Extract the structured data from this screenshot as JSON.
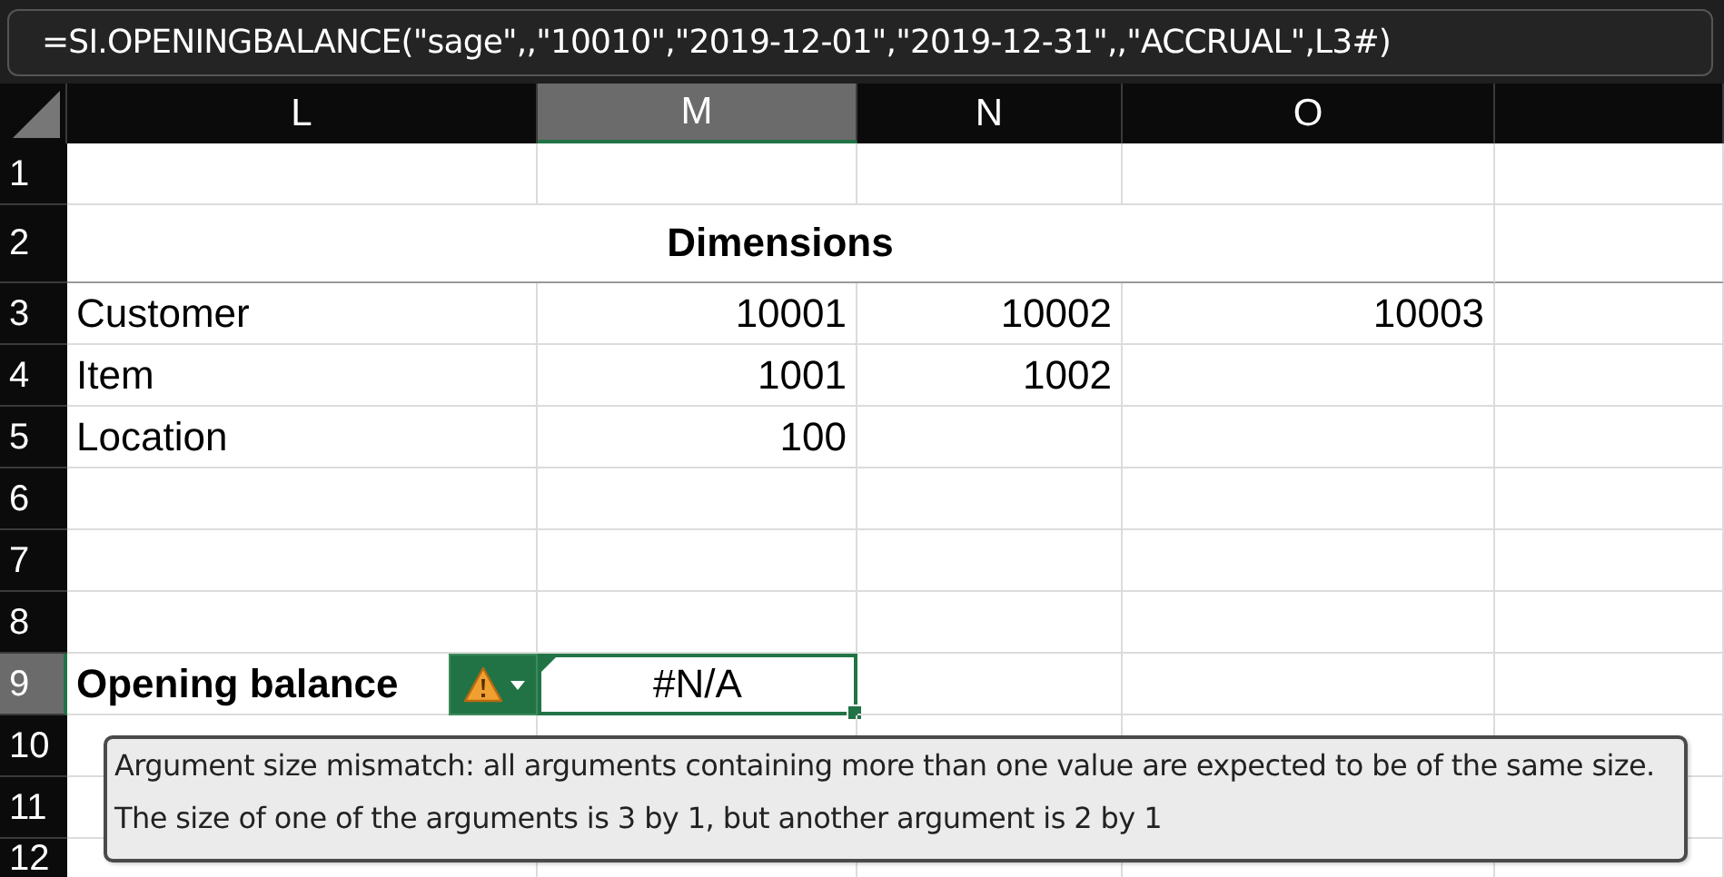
{
  "formula_bar": {
    "value": "=SI.OPENINGBALANCE(\"sage\",,\"10010\",\"2019-12-01\",\"2019-12-31\",,\"ACCRUAL\",L3#)"
  },
  "columns": [
    {
      "label": "L",
      "selected": false
    },
    {
      "label": "M",
      "selected": true
    },
    {
      "label": "N",
      "selected": false
    },
    {
      "label": "O",
      "selected": false
    }
  ],
  "rows": [
    {
      "number": "1",
      "selected": false
    },
    {
      "number": "2",
      "selected": false,
      "kind": "heading",
      "title": "Dimensions"
    },
    {
      "number": "3",
      "selected": false,
      "cells": {
        "L": "Customer",
        "M": "10001",
        "N": "10002",
        "O": "10003"
      }
    },
    {
      "number": "4",
      "selected": false,
      "cells": {
        "L": "Item",
        "M": "1001",
        "N": "1002"
      }
    },
    {
      "number": "5",
      "selected": false,
      "cells": {
        "L": "Location",
        "M": "100"
      }
    },
    {
      "number": "6",
      "selected": false
    },
    {
      "number": "7",
      "selected": false
    },
    {
      "number": "8",
      "selected": false
    },
    {
      "number": "9",
      "selected": true,
      "kind": "result",
      "error": true,
      "cells": {
        "L": "Opening balance",
        "M": "#N/A"
      }
    },
    {
      "number": "10",
      "selected": false
    },
    {
      "number": "11",
      "selected": false
    },
    {
      "number": "12",
      "selected": false
    }
  ],
  "error_tooltip": {
    "lines": [
      "Argument size mismatch: all arguments containing more than one value are expected to be of the same size.",
      "The size of one of the arguments is 3 by 1, but another argument is 2 by 1"
    ]
  }
}
